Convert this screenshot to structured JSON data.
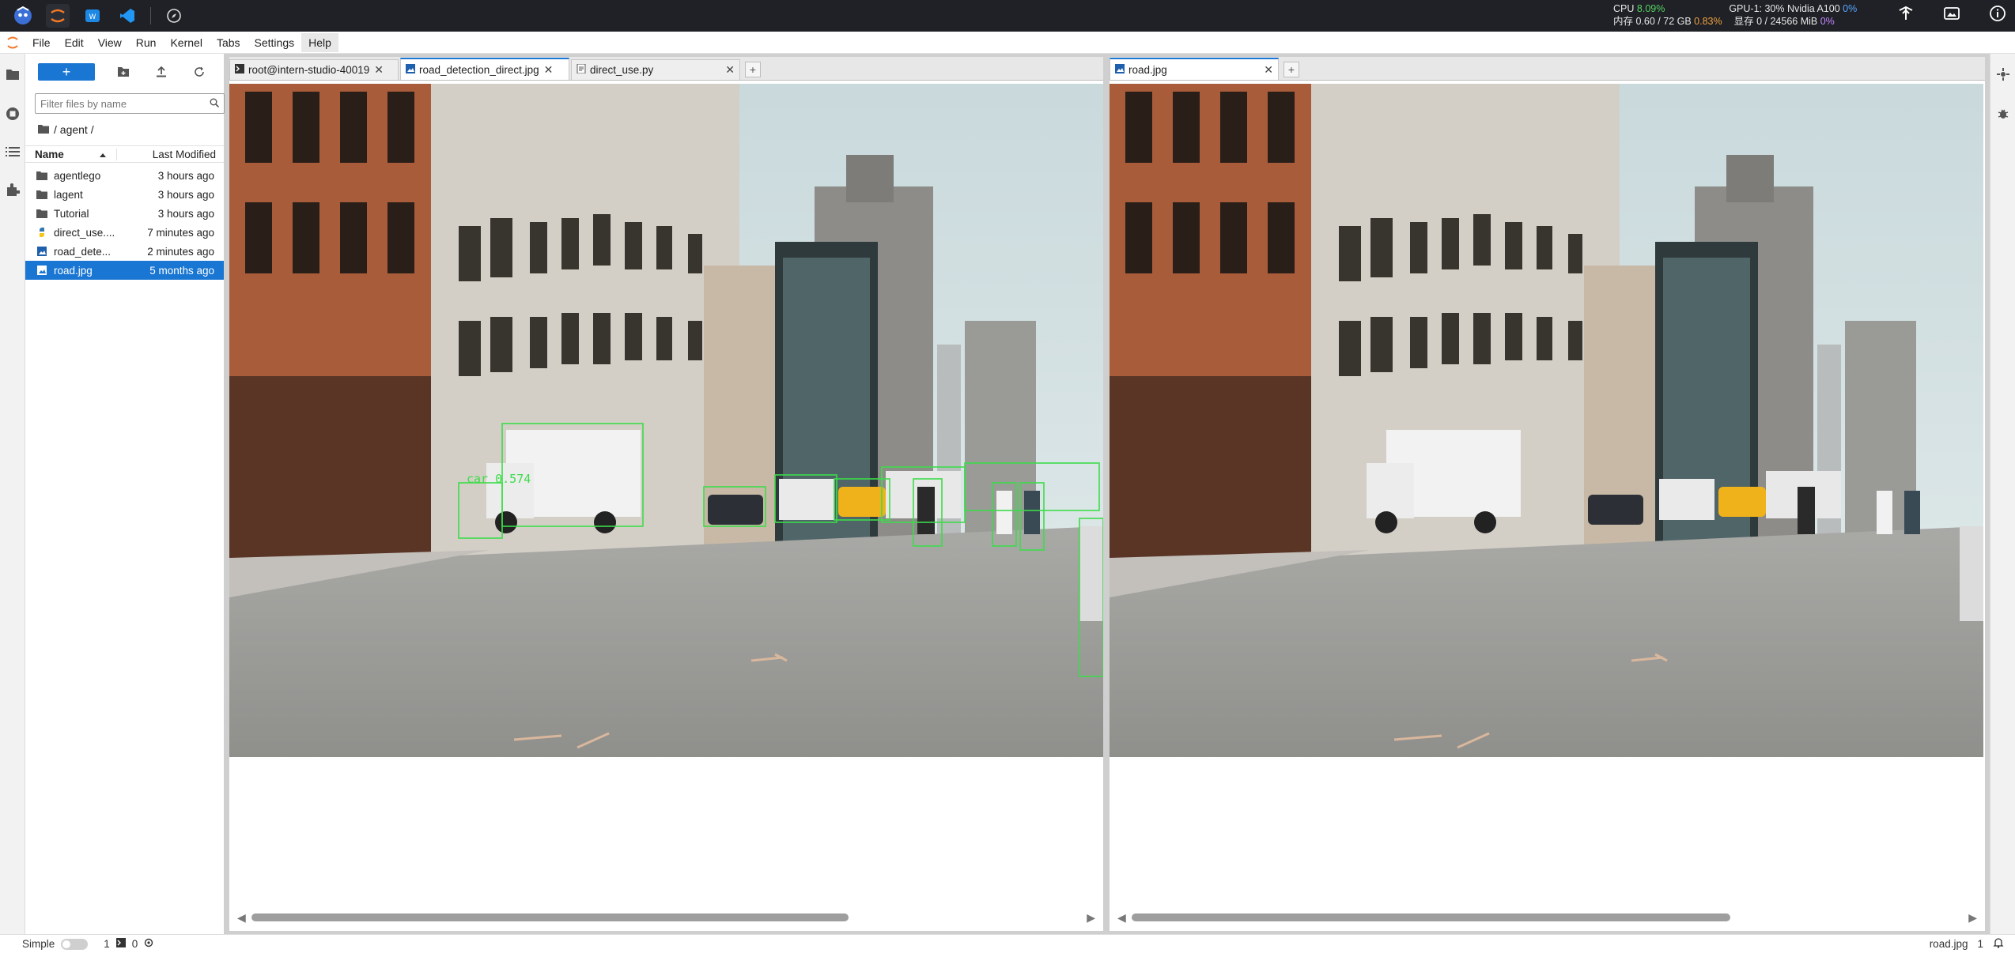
{
  "topbar": {
    "cpu_label": "CPU",
    "cpu_value": "8.09%",
    "mem_label": "内存",
    "mem_value": "0.60 / 72 GB",
    "mem_pct": "0.83%",
    "gpu_label": "GPU-1: 30% Nvidia A100",
    "gpu_pct": "0%",
    "vram_label": "显存",
    "vram_value": "0 / 24566 MiB",
    "vram_pct": "0%"
  },
  "menu": {
    "items": [
      "File",
      "Edit",
      "View",
      "Run",
      "Kernel",
      "Tabs",
      "Settings",
      "Help"
    ]
  },
  "filebrowser": {
    "new_label": "+",
    "filter_placeholder": "Filter files by name",
    "breadcrumb": "/ agent /",
    "col_name": "Name",
    "col_modified": "Last Modified",
    "files": [
      {
        "name": "agentlego",
        "modified": "3 hours ago",
        "icon": "folder-icon"
      },
      {
        "name": "lagent",
        "modified": "3 hours ago",
        "icon": "folder-icon"
      },
      {
        "name": "Tutorial",
        "modified": "3 hours ago",
        "icon": "folder-icon"
      },
      {
        "name": "direct_use....",
        "modified": "7 minutes ago",
        "icon": "python-file-icon"
      },
      {
        "name": "road_dete...",
        "modified": "2 minutes ago",
        "icon": "image-file-icon"
      },
      {
        "name": "road.jpg",
        "modified": "5 months ago",
        "icon": "image-file-icon"
      }
    ]
  },
  "left_panel": {
    "tabs": [
      {
        "label": "root@intern-studio-40019",
        "icon": "terminal-icon"
      },
      {
        "label": "road_detection_direct.jpg",
        "icon": "image-file-icon"
      },
      {
        "label": "direct_use.py",
        "icon": "python-file-icon"
      }
    ],
    "active_tab": 1
  },
  "right_panel": {
    "tabs": [
      {
        "label": "road.jpg",
        "icon": "image-file-icon"
      }
    ],
    "active_tab": 0
  },
  "detection_label": "car 0.574",
  "statusbar": {
    "mode_label": "Simple",
    "count_a": "1",
    "count_b": "0",
    "file_label": "road.jpg",
    "line_count": "1"
  },
  "colors": {
    "accent": "#1976d2",
    "detection_box": "#3ddc4a",
    "topbar_bg": "#1f2126"
  }
}
